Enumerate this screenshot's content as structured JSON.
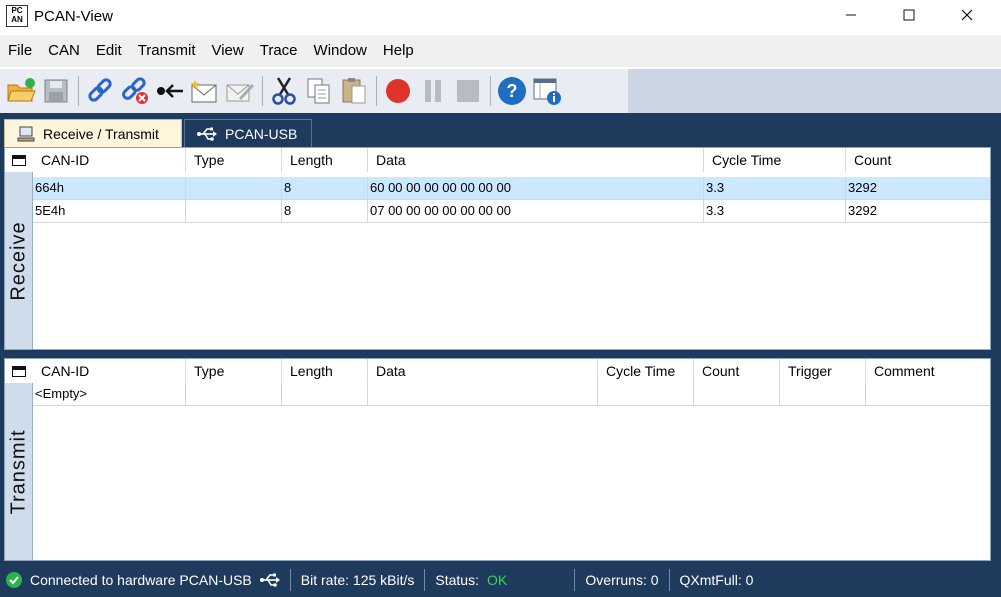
{
  "window": {
    "title": "PCAN-View",
    "app_icon_text": "PC\nAN"
  },
  "menu": [
    "File",
    "CAN",
    "Edit",
    "Transmit",
    "View",
    "Trace",
    "Window",
    "Help"
  ],
  "tabs": {
    "receive_transmit": "Receive / Transmit",
    "hardware": "PCAN-USB"
  },
  "receive": {
    "side_label": "Receive",
    "columns": [
      "CAN-ID",
      "Type",
      "Length",
      "Data",
      "Cycle Time",
      "Count"
    ],
    "rows": [
      {
        "can_id": "664h",
        "type": "",
        "length": "8",
        "data": "60 00 00 00 00 00 00 00",
        "cycle_time": "3.3",
        "count": "3292"
      },
      {
        "can_id": "5E4h",
        "type": "",
        "length": "8",
        "data": "07 00 00 00 00 00 00 00",
        "cycle_time": "3.3",
        "count": "3292"
      }
    ]
  },
  "transmit": {
    "side_label": "Transmit",
    "columns": [
      "CAN-ID",
      "Type",
      "Length",
      "Data",
      "Cycle Time",
      "Count",
      "Trigger",
      "Comment"
    ],
    "rows": [
      {
        "can_id": "<Empty>"
      }
    ]
  },
  "status": {
    "connection": "Connected to hardware PCAN-USB",
    "bitrate": "Bit rate: 125 kBit/s",
    "status_label": "Status:",
    "status_value": "OK",
    "overruns": "Overruns: 0",
    "qxmtfull": "QXmtFull: 0"
  },
  "colors": {
    "accent_dark": "#1e3a5c",
    "selection": "#cce8ff",
    "ok_green": "#3fcf5a"
  }
}
